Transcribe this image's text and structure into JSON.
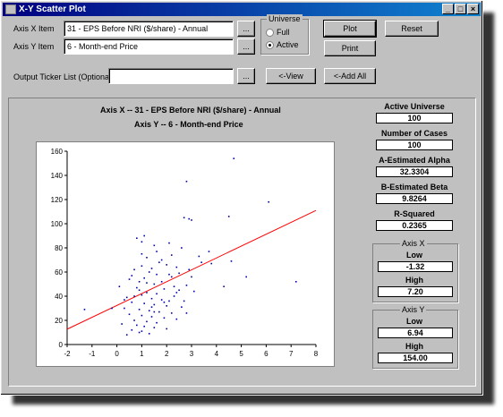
{
  "window": {
    "title": "X-Y Scatter Plot"
  },
  "form": {
    "axis_x_label": "Axis X Item",
    "axis_x_value": "31 - EPS Before NRI ($/share) - Annual",
    "axis_y_label": "Axis Y Item",
    "axis_y_value": "6 - Month-end Price",
    "output_label": "Output Ticker List (Optional)",
    "output_value": "",
    "browse_label": "...",
    "universe_label": "Universe",
    "universe_full": "Full",
    "universe_active": "Active",
    "plot_button": "Plot",
    "reset_button": "Reset",
    "print_button": "Print",
    "view_button": "<-View",
    "addall_button": "<-Add All"
  },
  "chart_titles": {
    "x": "Axis X -- 31 - EPS Before NRI ($/share) - Annual",
    "y": "Axis Y -- 6 - Month-end Price"
  },
  "stats": {
    "active_universe_label": "Active Universe",
    "active_universe": "100",
    "num_cases_label": "Number of Cases",
    "num_cases": "100",
    "alpha_label": "A-Estimated Alpha",
    "alpha": "32.3304",
    "beta_label": "B-Estimated Beta",
    "beta": "9.8264",
    "rsq_label": "R-Squared",
    "rsq": "0.2365",
    "axis_x_group": "Axis X",
    "x_low_label": "Low",
    "x_low": "-1.32",
    "x_high_label": "High",
    "x_high": "7.20",
    "axis_y_group": "Axis Y",
    "y_low_label": "Low",
    "y_low": "6.94",
    "y_high_label": "High",
    "y_high": "154.00"
  },
  "chart_data": {
    "type": "scatter",
    "xlim": [
      -2,
      8
    ],
    "ylim": [
      0,
      160
    ],
    "xticks": [
      -2,
      -1,
      0,
      1,
      2,
      3,
      4,
      5,
      6,
      7,
      8
    ],
    "yticks": [
      0,
      20,
      40,
      60,
      80,
      100,
      120,
      140,
      160
    ],
    "grid": false,
    "point_color": "#0000aa",
    "line_color": "#ff0000",
    "regression": {
      "alpha": 32.3304,
      "beta": 9.8264,
      "x_range": [
        -2,
        8
      ]
    },
    "points": [
      [
        4.7,
        154
      ],
      [
        2.8,
        135
      ],
      [
        6.1,
        118
      ],
      [
        2.7,
        105
      ],
      [
        2.9,
        104
      ],
      [
        3.0,
        103
      ],
      [
        4.5,
        106
      ],
      [
        1.1,
        90
      ],
      [
        1.0,
        85
      ],
      [
        2.1,
        84
      ],
      [
        1.5,
        82
      ],
      [
        2.6,
        80
      ],
      [
        3.7,
        77
      ],
      [
        1.0,
        75
      ],
      [
        1.2,
        72
      ],
      [
        1.8,
        70
      ],
      [
        3.4,
        68
      ],
      [
        2.0,
        66
      ],
      [
        2.4,
        64
      ],
      [
        0.7,
        62
      ],
      [
        1.3,
        60
      ],
      [
        1.6,
        58
      ],
      [
        2.2,
        56
      ],
      [
        1.1,
        55
      ],
      [
        0.9,
        52
      ],
      [
        1.5,
        50
      ],
      [
        2.8,
        49
      ],
      [
        4.3,
        48
      ],
      [
        0.8,
        47
      ],
      [
        1.9,
        46
      ],
      [
        2.5,
        45
      ],
      [
        3.1,
        44
      ],
      [
        1.2,
        43
      ],
      [
        1.6,
        42
      ],
      [
        1.0,
        41
      ],
      [
        2.3,
        40
      ],
      [
        0.4,
        39
      ],
      [
        1.4,
        38
      ],
      [
        1.8,
        37
      ],
      [
        2.1,
        36
      ],
      [
        0.6,
        35
      ],
      [
        1.1,
        34
      ],
      [
        1.5,
        33
      ],
      [
        2.0,
        32
      ],
      [
        2.6,
        31
      ],
      [
        0.3,
        30
      ],
      [
        0.9,
        29
      ],
      [
        1.3,
        28
      ],
      [
        1.7,
        27
      ],
      [
        2.2,
        26
      ],
      [
        0.5,
        25
      ],
      [
        1.0,
        24
      ],
      [
        1.4,
        23
      ],
      [
        1.9,
        22
      ],
      [
        2.4,
        21
      ],
      [
        0.7,
        20
      ],
      [
        1.2,
        19
      ],
      [
        1.6,
        18
      ],
      [
        0.2,
        17
      ],
      [
        0.8,
        16
      ],
      [
        1.1,
        15
      ],
      [
        1.5,
        14
      ],
      [
        2.0,
        13
      ],
      [
        0.6,
        12
      ],
      [
        1.0,
        11
      ],
      [
        0.9,
        10
      ],
      [
        1.3,
        9
      ],
      [
        0.4,
        8
      ],
      [
        -0.2,
        30
      ],
      [
        -1.3,
        29
      ],
      [
        0.1,
        48
      ],
      [
        0.5,
        54
      ],
      [
        1.7,
        68
      ],
      [
        2.1,
        58
      ],
      [
        2.9,
        62
      ],
      [
        3.3,
        73
      ],
      [
        1.4,
        63
      ],
      [
        0.9,
        45
      ],
      [
        1.8,
        52
      ],
      [
        2.7,
        36
      ],
      [
        1.2,
        51
      ],
      [
        0.7,
        40
      ],
      [
        2.5,
        59
      ],
      [
        5.2,
        56
      ],
      [
        7.2,
        52
      ],
      [
        4.6,
        69
      ],
      [
        3.8,
        67
      ],
      [
        2.3,
        48
      ],
      [
        1.6,
        77
      ],
      [
        1.9,
        35
      ],
      [
        0.3,
        37
      ],
      [
        1.0,
        65
      ],
      [
        2.8,
        26
      ],
      [
        1.4,
        31
      ],
      [
        0.8,
        88
      ],
      [
        2.2,
        74
      ],
      [
        3.0,
        56
      ],
      [
        1.5,
        27
      ],
      [
        0.6,
        57
      ],
      [
        2.4,
        43
      ]
    ]
  }
}
